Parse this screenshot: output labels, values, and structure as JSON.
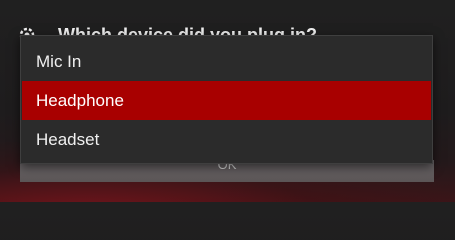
{
  "dialog": {
    "title": "Which device did you plug in?",
    "header_icon": "gear-icon",
    "footer_label": "OK"
  },
  "dropdown": {
    "options": [
      {
        "label": "Mic In",
        "selected": false
      },
      {
        "label": "Headphone",
        "selected": true
      },
      {
        "label": "Headset",
        "selected": false
      }
    ],
    "highlight_color": "#a80000"
  }
}
